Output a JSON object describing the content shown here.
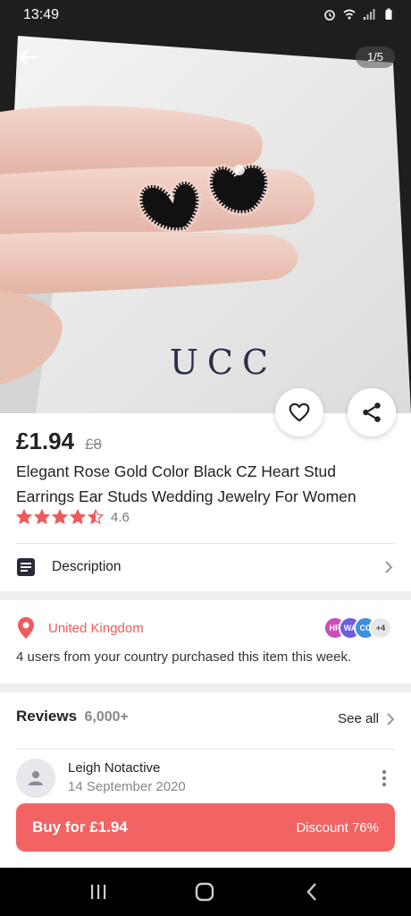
{
  "status_bar": {
    "time": "13:49"
  },
  "gallery": {
    "counter": "1/5",
    "box_text": "UCC"
  },
  "product": {
    "price": "£1.94",
    "old_price": "£8",
    "title": "Elegant Rose Gold Color Black CZ Heart Stud Earrings Ear Studs Wedding Jewelry For Women",
    "rating": "4.6",
    "rating_stars": 4.5
  },
  "description": {
    "label": "Description"
  },
  "location": {
    "country": "United Kingdom",
    "avatars": [
      {
        "initials": "HR",
        "color": "#c94fb6"
      },
      {
        "initials": "WA",
        "color": "#6d5be0"
      },
      {
        "initials": "CC",
        "color": "#3f8fe0"
      },
      {
        "initials": "+4",
        "color": "#e6e6ea"
      }
    ],
    "purchased_text": "4 users from your country purchased this item this week."
  },
  "reviews": {
    "title": "Reviews",
    "count": "6,000+",
    "see_all": "See all",
    "items": [
      {
        "name": "Leigh Notactive",
        "date": "14 September 2020"
      }
    ]
  },
  "buy_bar": {
    "buy_label": "Buy for £1.94",
    "discount_label": "Discount 76%"
  },
  "colors": {
    "accent": "#f26363",
    "star": "#ef5b5b",
    "location": "#ef5b5b"
  }
}
